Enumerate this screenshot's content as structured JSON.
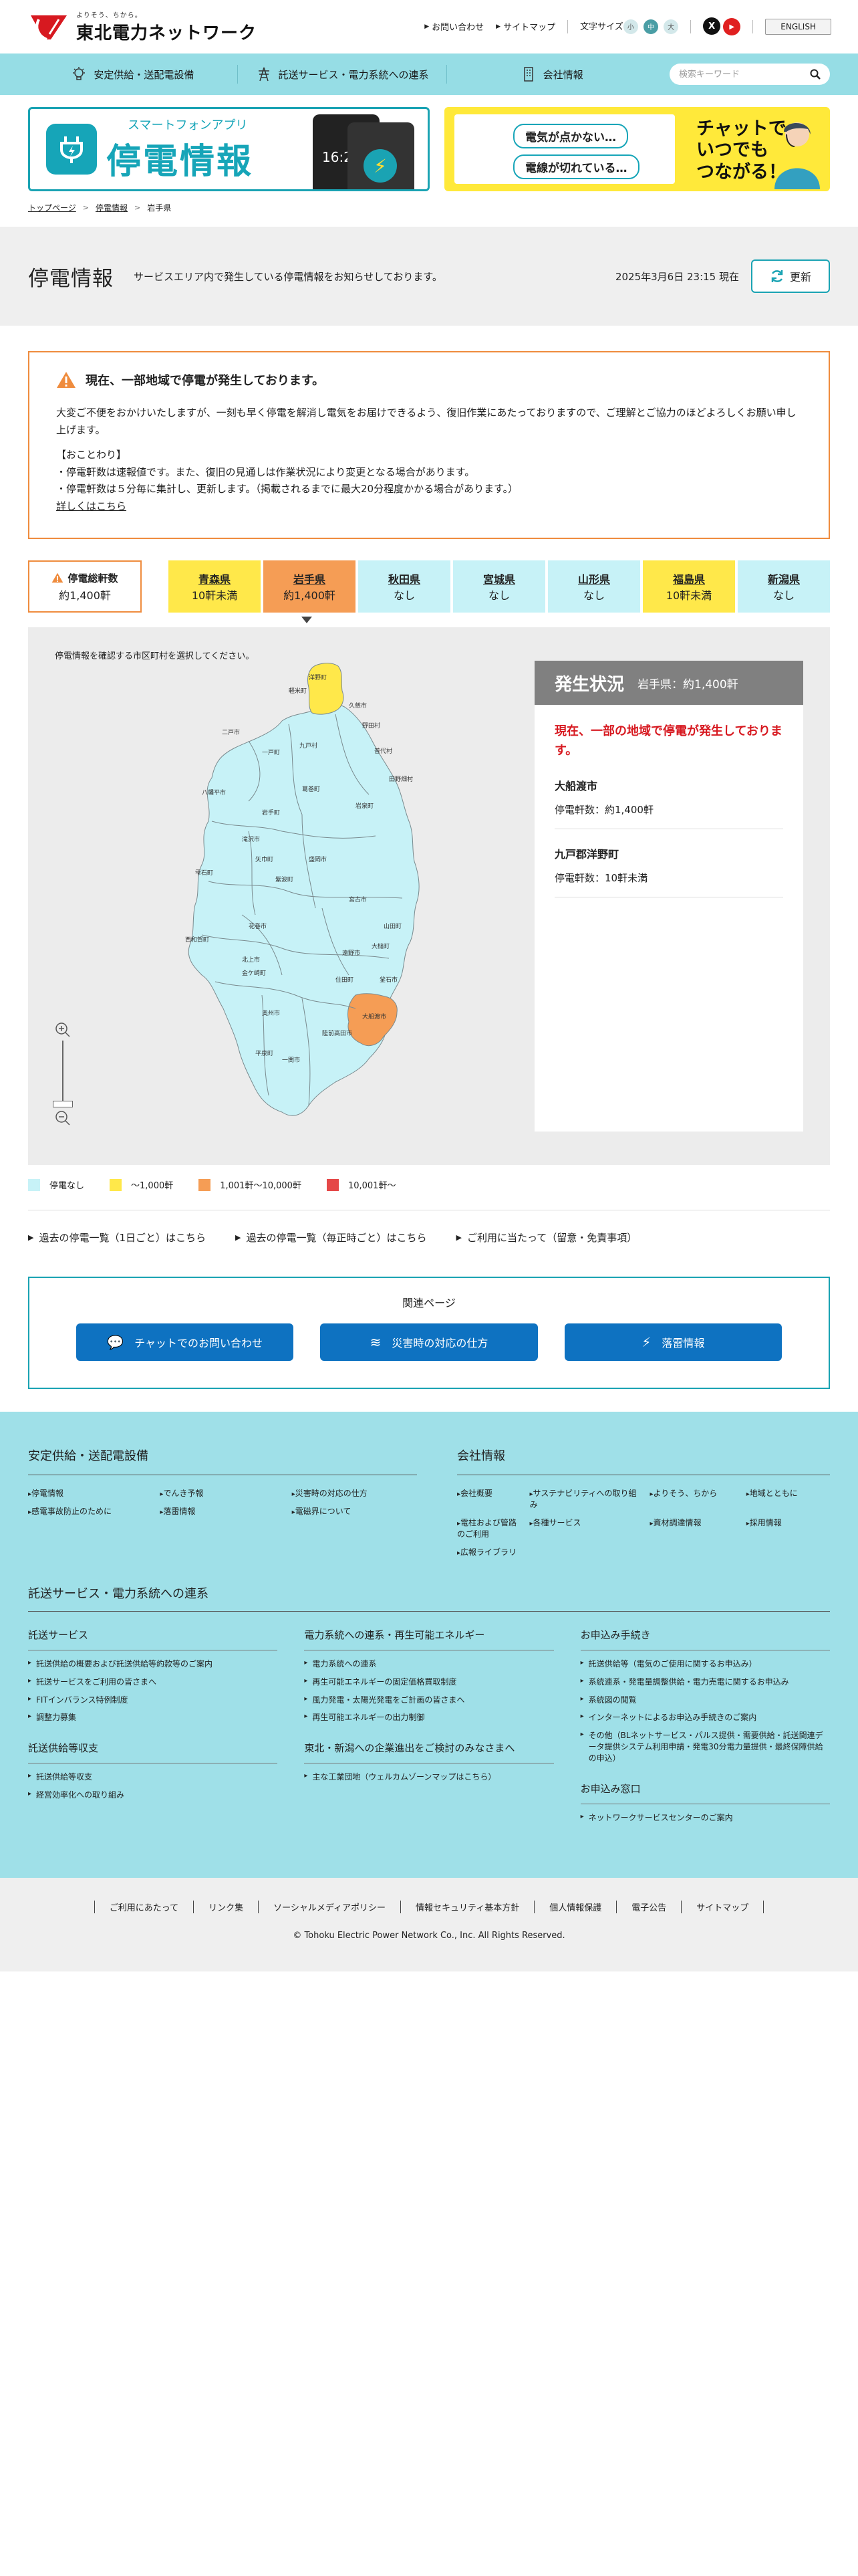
{
  "header": {
    "logo_tagline": "よりそう、ちから。",
    "logo_name": "東北電力ネットワーク",
    "contact": "お問い合わせ",
    "sitemap": "サイトマップ",
    "font_size_label": "文字サイズ",
    "font_sizes": [
      "小",
      "中",
      "大"
    ],
    "x_label": "X",
    "youtube_label": "▶",
    "english": "ENGLISH"
  },
  "gnav": {
    "items": [
      {
        "label": "安定供給・送配電設備",
        "icon": "bulb-icon"
      },
      {
        "label": "託送サービス・電力系統への連系",
        "icon": "tower-icon"
      },
      {
        "label": "会社情報",
        "icon": "building-icon"
      }
    ],
    "search_placeholder": "検索キーワード"
  },
  "banners": {
    "app_sub": "スマートフォンアプリ",
    "app_main": "停電情報",
    "phone_time": "16:21",
    "chat_bubble1": "電気が点かない…",
    "chat_bubble2": "電線が切れている…",
    "chat_line1": "チャットで",
    "chat_line2": "いつでも",
    "chat_line3": "つながる！"
  },
  "breadcrumb": [
    "トップページ",
    "停電情報",
    "岩手県"
  ],
  "page": {
    "title": "停電情報",
    "description": "サービスエリア内で発生している停電情報をお知らせしております。",
    "timestamp": "2025年3月6日 23:15 現在",
    "refresh_label": "更新"
  },
  "alert": {
    "title": "現在、一部地域で停電が発生しております。",
    "body": "大変ご不便をおかけいたしますが、一刻も早く停電を解消し電気をお届けできるよう、復旧作業にあたっておりますので、ご理解とご協力のほどよろしくお願い申し上げます。",
    "notice_head": "【おことわり】",
    "notice1": "・停電軒数は速報値です。また、復旧の見通しは作業状況により変更となる場合があります。",
    "notice2": "・停電軒数は５分毎に集計し、更新します。（掲載されるまでに最大20分程度かかる場合があります。）",
    "more_link": "詳しくはこちら"
  },
  "summary": {
    "total_label": "停電総軒数",
    "total_value": "約1,400軒",
    "prefectures": [
      {
        "name": "青森県",
        "value": "10軒未満",
        "level": 1
      },
      {
        "name": "岩手県",
        "value": "約1,400軒",
        "level": 2
      },
      {
        "name": "秋田県",
        "value": "なし",
        "level": 0
      },
      {
        "name": "宮城県",
        "value": "なし",
        "level": 0
      },
      {
        "name": "山形県",
        "value": "なし",
        "level": 0
      },
      {
        "name": "福島県",
        "value": "10軒未満",
        "level": 1
      },
      {
        "name": "新潟県",
        "value": "なし",
        "level": 0
      }
    ]
  },
  "map": {
    "hint": "停電情報を確認する市区町村を選択してください。",
    "zoom_in": "+",
    "zoom_out": "−",
    "municipalities": [
      "洋野町",
      "軽米町",
      "久慈市",
      "二戸市",
      "一戸町",
      "九戸村",
      "野田村",
      "普代村",
      "八幡平市",
      "葛巻町",
      "岩泉町",
      "田野畑村",
      "岩手町",
      "盛岡市",
      "滝沢市",
      "雫石町",
      "紫波町",
      "矢巾町",
      "宮古市",
      "花巻市",
      "遠野市",
      "山田町",
      "大槌町",
      "釜石市",
      "西和賀町",
      "北上市",
      "金ケ崎町",
      "奥州市",
      "住田町",
      "大船渡市",
      "陸前高田市",
      "一関市",
      "平泉町"
    ]
  },
  "status": {
    "title": "発生状況",
    "subtitle": "岩手県：約1,400軒",
    "alert": "現在、一部の地域で停電が発生しております。",
    "cities": [
      {
        "name": "大船渡市",
        "count": "停電軒数：約1,400軒"
      },
      {
        "name": "九戸郡洋野町",
        "count": "停電軒数：10軒未満"
      }
    ]
  },
  "legend": [
    {
      "label": "停電なし",
      "color": "#c7f2f7"
    },
    {
      "label": "〜1,000軒",
      "color": "#ffe84a"
    },
    {
      "label": "1,001軒〜10,000軒",
      "color": "#f59d55"
    },
    {
      "label": "10,001軒〜",
      "color": "#e54848"
    }
  ],
  "links": [
    "過去の停電一覧（1日ごと）はこちら",
    "過去の停電一覧（毎正時ごと）はこちら",
    "ご利用に当たって（留意・免責事項）"
  ],
  "related": {
    "title": "関連ページ",
    "buttons": [
      {
        "label": "チャットでのお問い合わせ",
        "icon": "chat-icon"
      },
      {
        "label": "災害時の対応の仕方",
        "icon": "disaster-icon"
      },
      {
        "label": "落雷情報",
        "icon": "lightning-icon"
      }
    ]
  },
  "footer": {
    "supply_title": "安定供給・送配電設備",
    "supply_items": [
      "停電情報",
      "でんき予報",
      "災害時の対応の仕方",
      "感電事故防止のために",
      "落雷情報",
      "電磁界について"
    ],
    "company_title": "会社情報",
    "company_items": [
      "会社概要",
      "サステナビリティへの取り組み",
      "よりそう、ちから",
      "地域とともに",
      "電柱および管路のご利用",
      "各種サービス",
      "資材調達情報",
      "採用情報",
      "広報ライブラリ"
    ],
    "service_title": "託送サービス・電力系統への連系",
    "col1_head": "託送サービス",
    "col1_items": [
      "託送供給の概要および託送供給等約款等のご案内",
      "託送サービスをご利用の皆さまへ",
      "FITインバランス特例制度",
      "調整力募集"
    ],
    "col1b_head": "託送供給等収支",
    "col1b_items": [
      "託送供給等収支",
      "経営効率化への取り組み"
    ],
    "col2_head": "電力系統への連系・再生可能エネルギー",
    "col2_items": [
      "電力系統への連系",
      "再生可能エネルギーの固定価格買取制度",
      "風力発電・太陽光発電をご計画の皆さまへ",
      "再生可能エネルギーの出力制御"
    ],
    "col2b_head": "東北・新潟への企業進出をご検討のみなさまへ",
    "col2b_items": [
      "主な工業団地（ウェルカムゾーンマップはこちら）"
    ],
    "col3_head": "お申込み手続き",
    "col3_items": [
      "託送供給等（電気のご使用に関するお申込み）",
      "系統連系・発電量調整供給・電力売電に関するお申込み",
      "系統図の閲覧",
      "インターネットによるお申込み手続きのご案内",
      "その他（BLネットサービス・パルス提供・需要供給・託送関連データ提供システム利用申請・発電30分電力量提供・最終保障供給の申込）"
    ],
    "col3b_head": "お申込み窓口",
    "col3b_items": [
      "ネットワークサービスセンターのご案内"
    ]
  },
  "bottom": {
    "links": [
      "ご利用にあたって",
      "リンク集",
      "ソーシャルメディアポリシー",
      "情報セキュリティ基本方針",
      "個人情報保護",
      "電子公告",
      "サイトマップ"
    ],
    "copyright": "© Tohoku Electric Power Network Co., Inc. All Rights Reserved."
  }
}
